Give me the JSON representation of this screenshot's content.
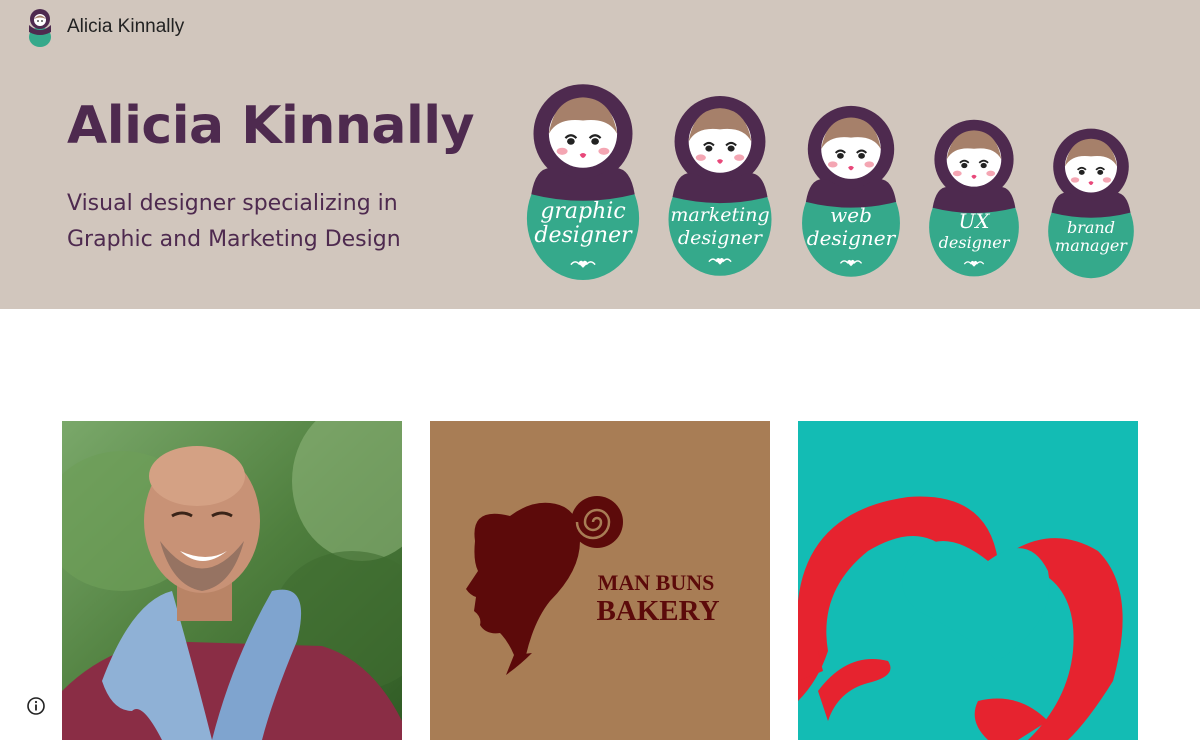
{
  "site": {
    "title": "Alicia Kinnally",
    "logo_icon": "matryoshka-logo-icon"
  },
  "hero": {
    "heading": "Alicia Kinnally",
    "subtitle_line1": "Visual designer specializing in",
    "subtitle_line2": "Graphic and Marketing Design"
  },
  "dolls": [
    {
      "line1": "graphic",
      "line2": "designer"
    },
    {
      "line1": "marketing",
      "line2": "designer"
    },
    {
      "line1": "web",
      "line2": "designer"
    },
    {
      "line1": "UX",
      "line2": "designer"
    },
    {
      "line1": "brand",
      "line2": "manager"
    }
  ],
  "gallery": [
    {
      "type": "photo",
      "icon": "portrait-photo"
    },
    {
      "type": "logo",
      "line1": "MAN BUNS",
      "line2": "BAKERY",
      "icon": "head-silhouette-icon"
    },
    {
      "type": "illustration",
      "icon": "heart-illustration"
    }
  ],
  "footer": {
    "info_icon": "info-icon"
  },
  "colors": {
    "header_bg": "#d1c6bd",
    "plum": "#4e2a4f",
    "teal": "#35a98b",
    "bakery_bg": "#a87d55",
    "bakery_ink": "#5c0a0a",
    "heart_bg": "#13bcb4",
    "heart_red": "#e6232f"
  }
}
